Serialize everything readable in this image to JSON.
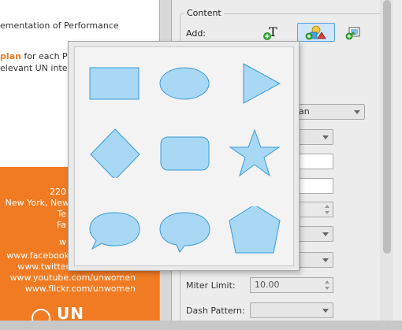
{
  "document": {
    "lines": [
      {
        "text": "ementation of Performance",
        "highlight": ""
      },
      {
        "text": " for each Pe",
        "highlight": "plan"
      },
      {
        "text": "elevant UN inter-",
        "highlight": ""
      }
    ],
    "footer": [
      "220",
      "New York, New",
      "Te",
      "Fa",
      "w",
      "www.facebook",
      "www.twitter",
      "www.youtube.com/unwomen",
      "www.flickr.com/unwomen"
    ],
    "logo_text": "UN"
  },
  "panel": {
    "group_title": "Content",
    "add_label": "Add:",
    "font_combo_value": "an",
    "fields": {
      "miter_limit_label": "Miter Limit:",
      "miter_limit_value": "10.00",
      "dash_pattern_label": "Dash Pattern:",
      "dash_pattern_value": ""
    }
  },
  "shape_palette": {
    "shapes": [
      "rectangle",
      "ellipse",
      "triangle",
      "diamond",
      "rounded-rectangle",
      "star",
      "rectangular-callout",
      "oval-callout",
      "pentagon"
    ],
    "fill": "#a8d8f4",
    "stroke": "#3a9ad6"
  },
  "colors": {
    "orange": "#f07b22",
    "accent_blue": "#5aa0e0"
  }
}
